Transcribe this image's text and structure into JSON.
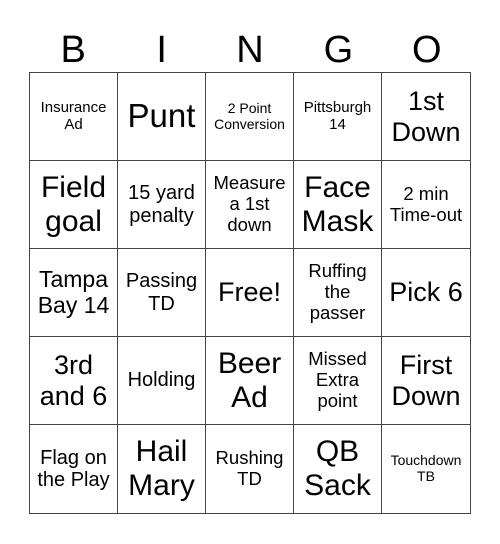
{
  "header": [
    "B",
    "I",
    "N",
    "G",
    "O"
  ],
  "cells": [
    {
      "text": "Insurance Ad"
    },
    {
      "text": "Punt"
    },
    {
      "text": "2 Point Conversion"
    },
    {
      "text": "Pittsburgh 14"
    },
    {
      "text": "1st Down"
    },
    {
      "text": "Field goal"
    },
    {
      "text": "15 yard penalty"
    },
    {
      "text": "Measure a 1st down"
    },
    {
      "text": "Face Mask"
    },
    {
      "text": "2 min Time-out"
    },
    {
      "text": "Tampa Bay 14"
    },
    {
      "text": "Passing TD"
    },
    {
      "text": "Free!"
    },
    {
      "text": "Ruffing the passer"
    },
    {
      "text": "Pick 6"
    },
    {
      "text": "3rd and 6"
    },
    {
      "text": "Holding"
    },
    {
      "text": "Beer Ad"
    },
    {
      "text": "Missed Extra point"
    },
    {
      "text": "First Down"
    },
    {
      "text": "Flag on the Play"
    },
    {
      "text": "Hail Mary"
    },
    {
      "text": "Rushing TD"
    },
    {
      "text": "QB Sack"
    },
    {
      "text": "Touchdown TB"
    }
  ]
}
